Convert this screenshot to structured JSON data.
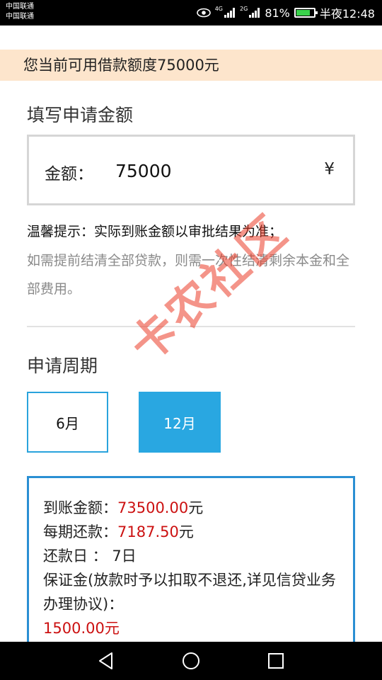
{
  "status_bar": {
    "carrier1": "中国联通",
    "carrier2": "中国联通",
    "net1": "4G",
    "net2": "2G",
    "battery": "81%",
    "time": "半夜12:48",
    "battery_level": 0.81,
    "battery_color": "#3ad24b"
  },
  "banner": {
    "text": "您当前可用借款额度75000元",
    "bg_color": "#fde5cc"
  },
  "apply": {
    "title": "填写申请金额",
    "amount_label": "金额：",
    "amount_value": "75000",
    "currency": "¥"
  },
  "tip": {
    "title": "温馨提示：实际到账金额以审批结果为准；",
    "note": "如需提前结清全部贷款，则需一次性结清剩余本金和全部费用。"
  },
  "period": {
    "title": "申请周期",
    "options": [
      {
        "label": "6月",
        "selected": false
      },
      {
        "label": "12月",
        "selected": true
      }
    ],
    "accent_color": "#29a7e1"
  },
  "details": {
    "arrival_label": "到账金额：",
    "arrival_value": "73500.00",
    "arrival_unit": "元",
    "installment_label": "每期还款：",
    "installment_value": "7187.50",
    "installment_unit": "元",
    "repay_day_label": "还款日 ：",
    "repay_day_value": "7日",
    "deposit_label": "保证金(放款时予以扣取不退还,详见信贷业务办理协议)：",
    "deposit_value": "1500.00元",
    "highlight_color": "#cc1111"
  },
  "watermark": {
    "text": "卡农社区"
  },
  "nav": {
    "back": "back-icon",
    "home": "home-icon",
    "recent": "recent-apps-icon"
  }
}
